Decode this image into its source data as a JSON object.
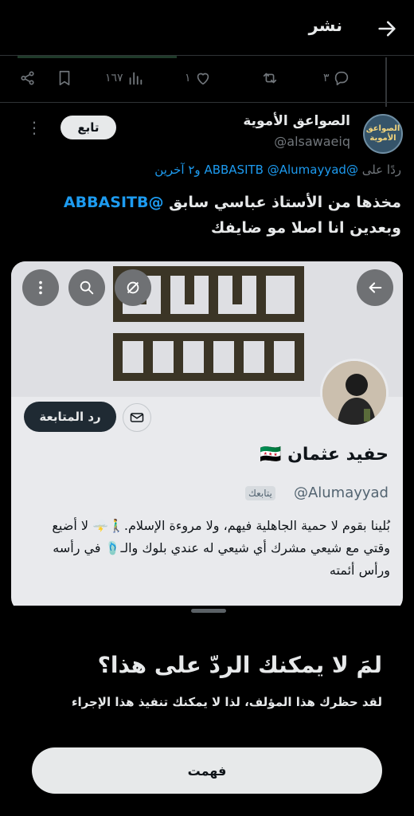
{
  "header": {
    "title": "نشر"
  },
  "actions": {
    "views": "١٦٧",
    "likes": "١",
    "replies": "٣"
  },
  "tweet": {
    "author_name": "الصواعق الأموية",
    "author_handle": "@alsawaeiq",
    "avatar_text": "الصواعق الأموية",
    "follow_label": "تابع",
    "replying_prefix": "ردًا على",
    "replying_users": "@ABBASITB @Alumayyad",
    "replying_suffix": "و٢ آخرين",
    "text_mention": "@ABBASITB",
    "text_line1": "مخذها من الأستاذ عباسي سابق",
    "text_line2": "وبعدين انا اصلا مو ضايفك"
  },
  "profile_card": {
    "name": "حفيد عثمان 🇸🇾",
    "handle": "@Alumayyad",
    "follows_you": "يتابعك",
    "follow_back_label": "رد المتابعة",
    "bio": "بُلينا بقوم لا حمية الجاهلية فيهم، ولا مروءة الإسلام.🚶‍♂️🌩️ لا أضيع وقتي مع شيعي مشرك أي شيعي له عندي بلوك والـ🩴 في رأسه ورأس أئمته"
  },
  "sheet": {
    "title": "لمَ لا يمكنك الردّ على هذا؟",
    "subtitle": "لقد حظرك هذا المؤلف، لذا لا يمكنك تنفيذ هذا الإجراء",
    "ok_label": "فهمت"
  },
  "colors": {
    "link": "#1d9bf0",
    "background": "#000000",
    "muted": "#71767b"
  }
}
